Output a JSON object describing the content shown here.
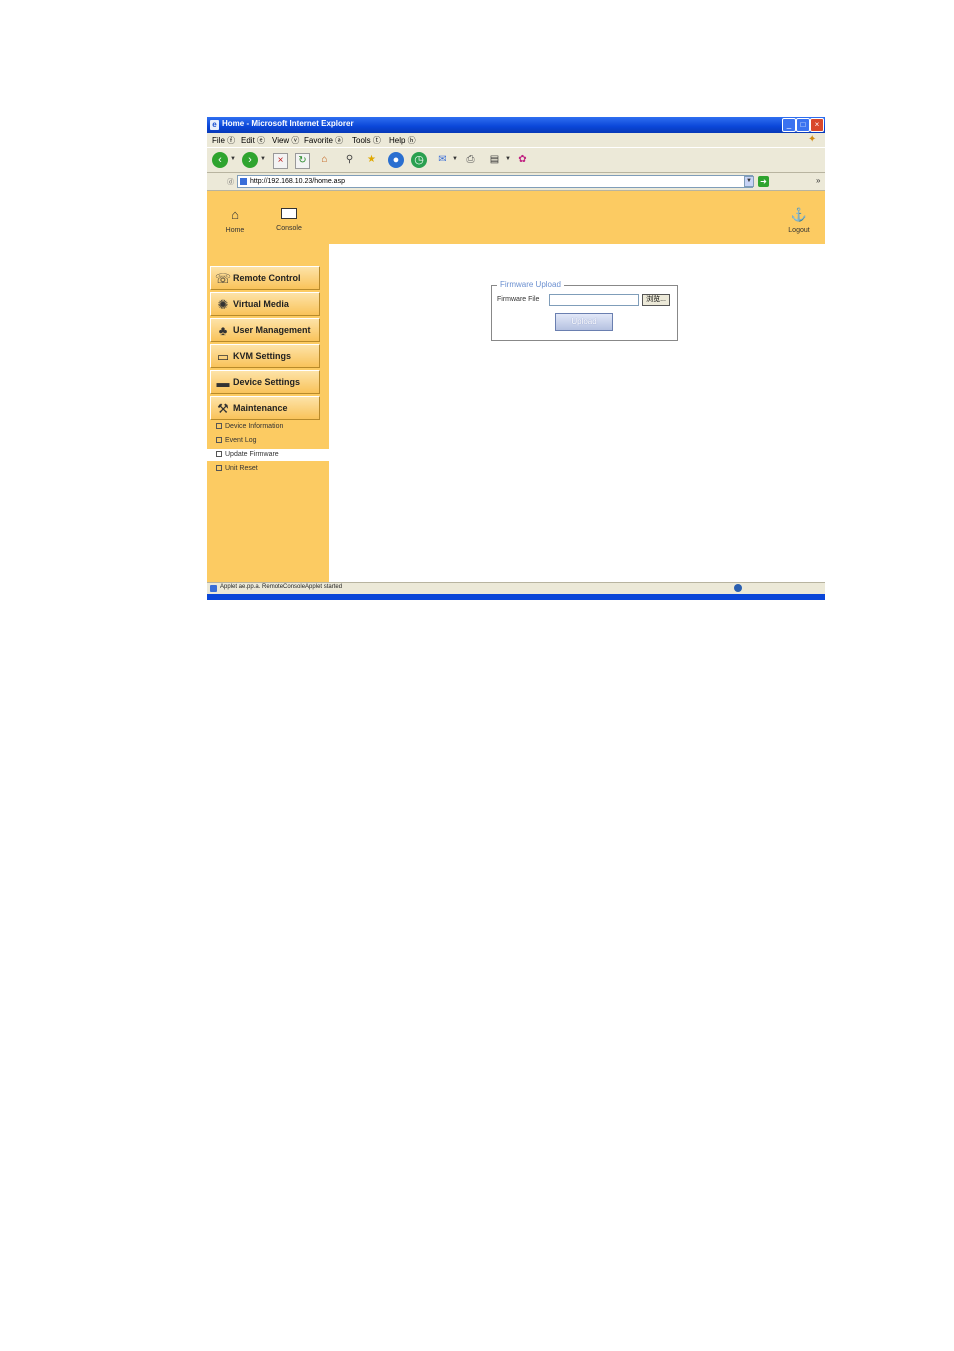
{
  "window": {
    "title": "Home - Microsoft Internet Explorer",
    "controls": {
      "minimize": "_",
      "maximize": "□",
      "close": "×"
    }
  },
  "menu": [
    "File ⓕ",
    "Edit ⓔ",
    "View ⓥ",
    "Favorite ⓐ",
    "Tools ⓣ",
    "Help ⓗ"
  ],
  "address": {
    "label": "ⓓ",
    "url": "http://192.168.10.23/home.asp"
  },
  "topnav": {
    "home": "Home",
    "console": "Console",
    "logout": "Logout"
  },
  "sidebar": {
    "buttons": [
      {
        "label": "Remote Control",
        "icon": "remote-control-icon"
      },
      {
        "label": "Virtual Media",
        "icon": "virtual-media-icon"
      },
      {
        "label": "User Management",
        "icon": "user-management-icon"
      },
      {
        "label": "KVM Settings",
        "icon": "kvm-settings-icon"
      },
      {
        "label": "Device Settings",
        "icon": "device-settings-icon"
      },
      {
        "label": "Maintenance",
        "icon": "maintenance-icon"
      }
    ],
    "submenu": [
      "Device Information",
      "Event Log",
      "Update Firmware",
      "Unit Reset"
    ],
    "active_submenu": "Update Firmware"
  },
  "firmware": {
    "legend": "Firmware Upload",
    "file_label": "Firmware File",
    "file_value": "",
    "browse_label": "浏览...",
    "upload_label": "Upload"
  },
  "status": {
    "text": "Applet ae.pp.a. RemoteConsoleApplet started"
  },
  "colors": {
    "panel_orange": "#fccb62",
    "titlebar_blue": "#0a46d8",
    "legend_blue": "#6a8fd0"
  }
}
